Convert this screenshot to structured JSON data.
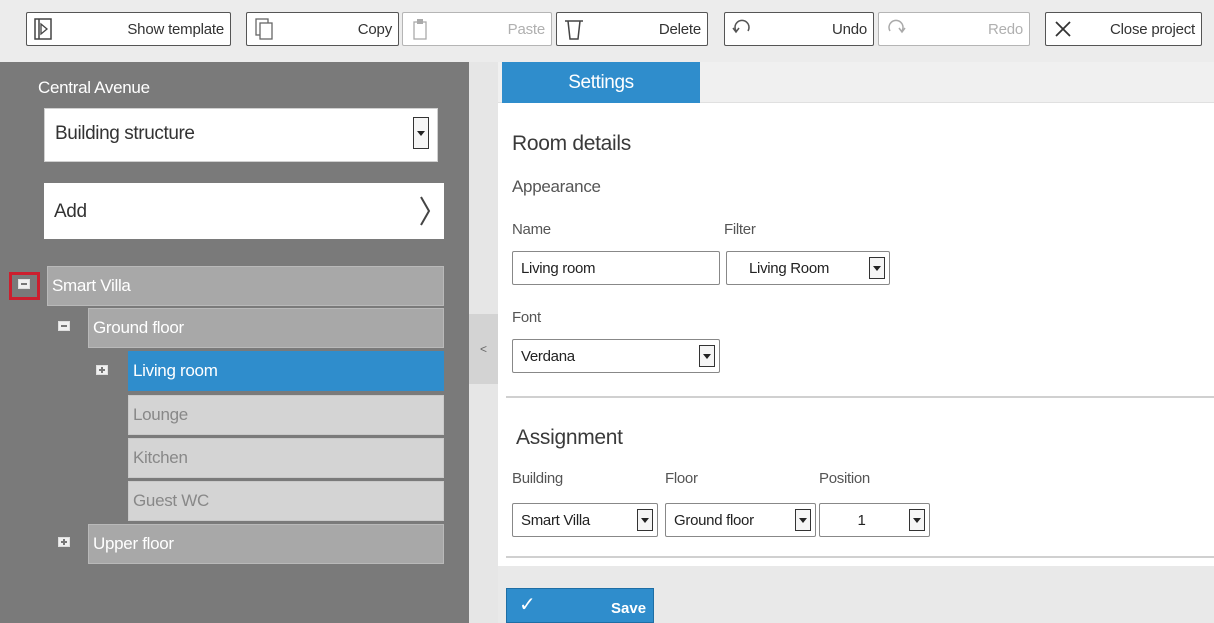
{
  "toolbar": {
    "show_template": "Show template",
    "copy": "Copy",
    "paste": "Paste",
    "delete": "Delete",
    "undo": "Undo",
    "redo": "Redo",
    "close_project": "Close project"
  },
  "sidebar": {
    "project_title": "Central Avenue",
    "view_select": "Building structure",
    "add_label": "Add",
    "tree": {
      "root": "Smart Villa",
      "ground_floor": "Ground floor",
      "rooms": [
        "Living room",
        "Lounge",
        "Kitchen",
        "Guest WC"
      ],
      "upper_floor": "Upper floor"
    },
    "collapse_glyph": "<"
  },
  "main": {
    "tab_label": "Settings",
    "room_details_heading": "Room details",
    "appearance_heading": "Appearance",
    "name_label": "Name",
    "name_value": "Living room",
    "filter_label": "Filter",
    "filter_value": "Living Room",
    "font_label": "Font",
    "font_value": "Verdana",
    "assignment_heading": "Assignment",
    "building_label": "Building",
    "building_value": "Smart Villa",
    "floor_label": "Floor",
    "floor_value": "Ground floor",
    "position_label": "Position",
    "position_value": "1",
    "save_label": "Save",
    "save_check": "✓"
  },
  "colors": {
    "accent": "#2f8dcc",
    "sidebar_bg": "#7a7a7a",
    "highlight_border": "#cc1f2e"
  }
}
